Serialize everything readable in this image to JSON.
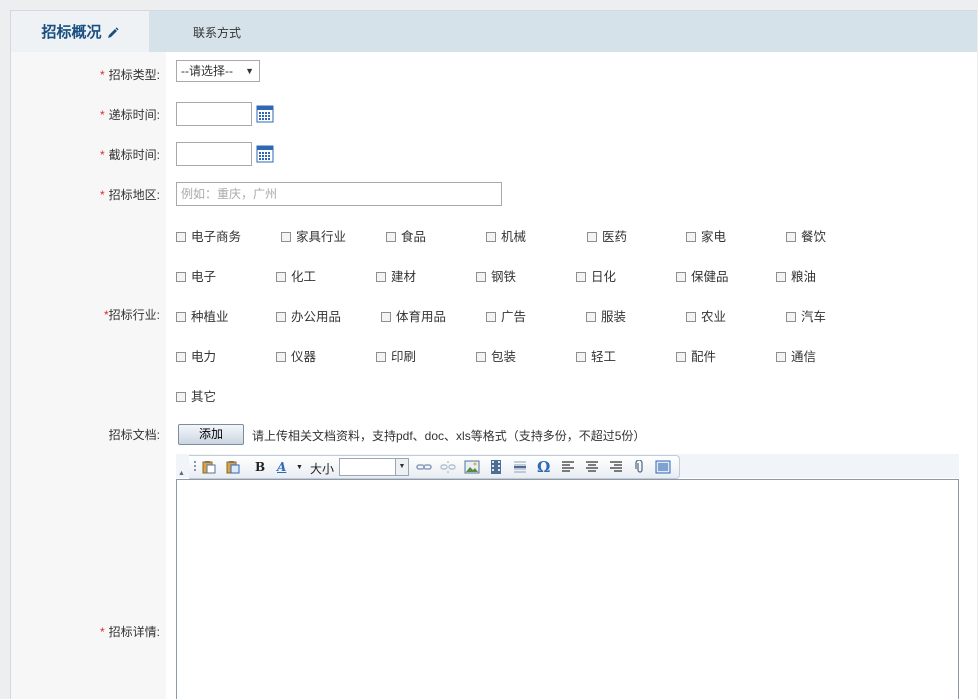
{
  "tabs": [
    {
      "label": "招标概况",
      "active": true,
      "icon": "pencil-icon"
    },
    {
      "label": "联系方式",
      "active": false
    }
  ],
  "form": {
    "required_mark": "*",
    "type": {
      "label": "招标类型:",
      "value": "--请选择--"
    },
    "bid_time": {
      "label": "递标时间:",
      "value": ""
    },
    "close_time": {
      "label": "截标时间:",
      "value": ""
    },
    "region": {
      "label": "招标地区:",
      "placeholder": "例如：重庆，广州"
    },
    "industry": {
      "label": "招标行业:",
      "options": [
        "电子商务",
        "家具行业",
        "食品",
        "机械",
        "医药",
        "家电",
        "餐饮",
        "电子",
        "化工",
        "建材",
        "钢铁",
        "日化",
        "保健品",
        "粮油",
        "种植业",
        "办公用品",
        "体育用品",
        "广告",
        "服装",
        "农业",
        "汽车",
        "电力",
        "仪器",
        "印刷",
        "包装",
        "轻工",
        "配件",
        "通信",
        "其它"
      ]
    },
    "docs": {
      "label": "招标文档:",
      "button": "添加",
      "hint": "请上传相关文档资料，支持pdf、doc、xls等格式（支持多份，不超过5份）"
    },
    "details": {
      "label": "招标详情:"
    }
  },
  "editor": {
    "font_size_label": "大小",
    "bold_label": "B",
    "font_color_label": "A"
  },
  "colors": {
    "accent": "#1a4f82",
    "required": "#e12b2b",
    "tabbar": "#d5e2ea"
  }
}
